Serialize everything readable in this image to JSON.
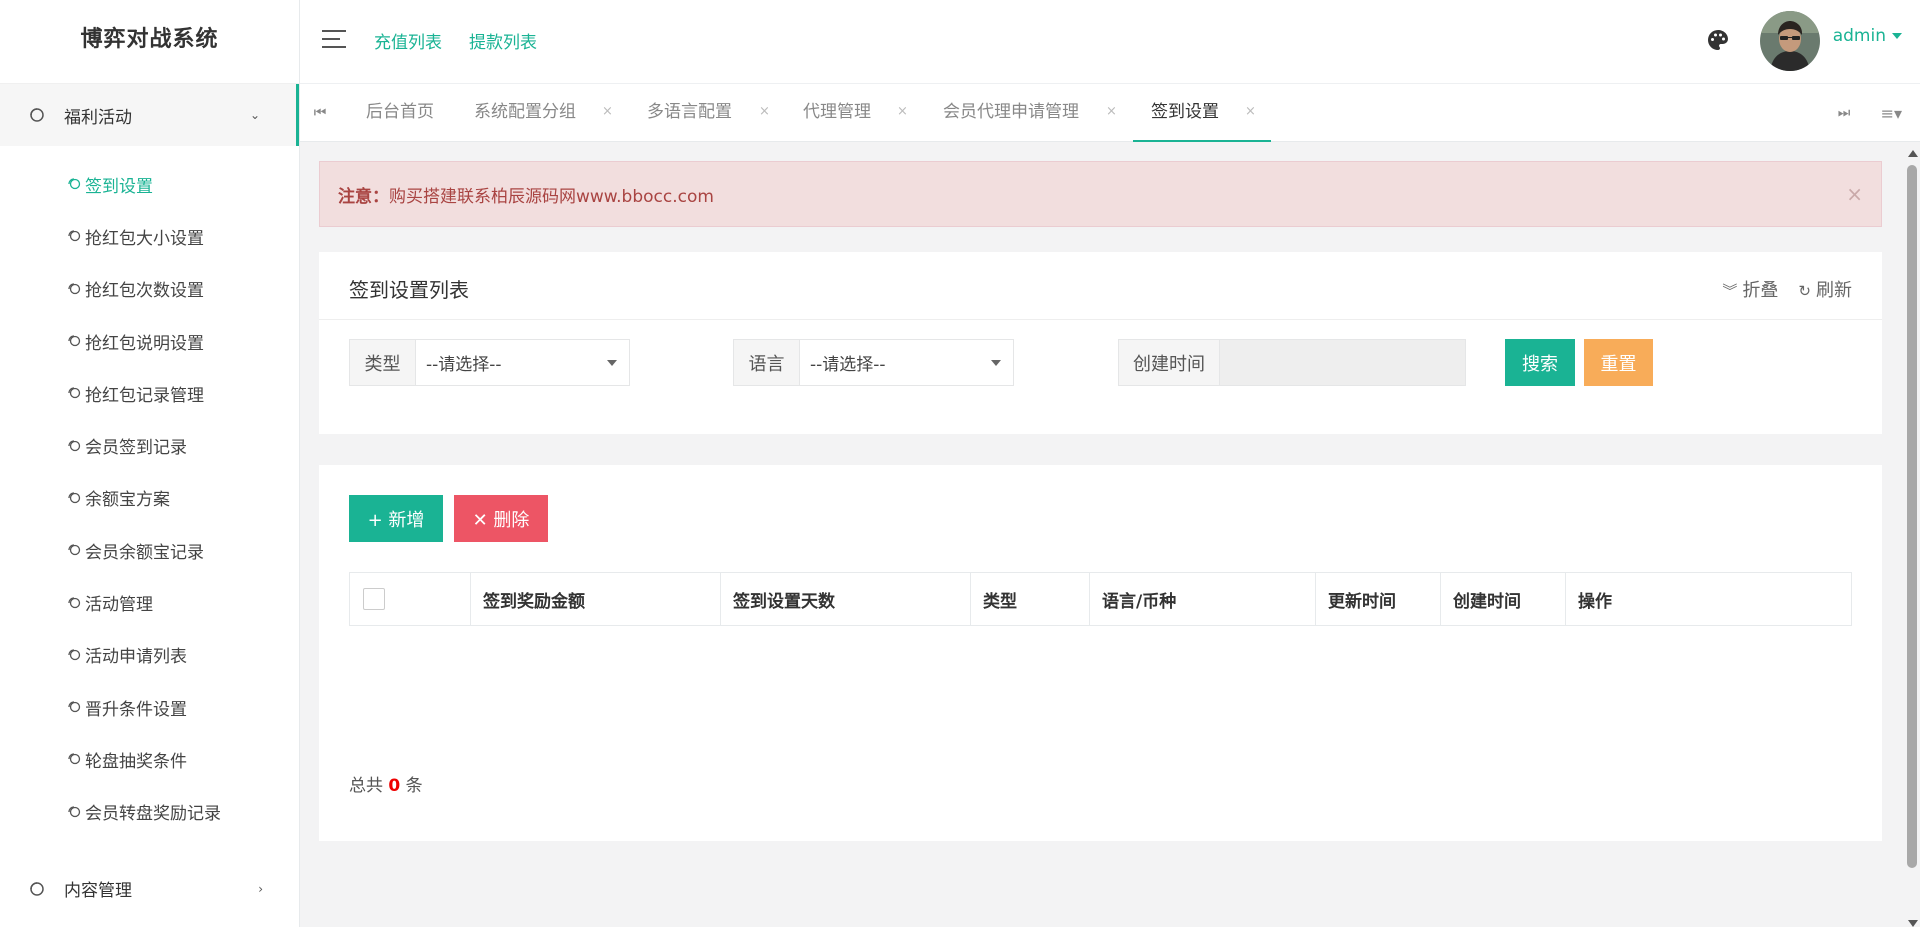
{
  "app": {
    "title": "博弈对战系统"
  },
  "sidebar": {
    "group1": {
      "label": "福利活动"
    },
    "items": [
      {
        "label": "签到设置"
      },
      {
        "label": "抢红包大小设置"
      },
      {
        "label": "抢红包次数设置"
      },
      {
        "label": "抢红包说明设置"
      },
      {
        "label": "抢红包记录管理"
      },
      {
        "label": "会员签到记录"
      },
      {
        "label": "余额宝方案"
      },
      {
        "label": "会员余额宝记录"
      },
      {
        "label": "活动管理"
      },
      {
        "label": "活动申请列表"
      },
      {
        "label": "晋升条件设置"
      },
      {
        "label": "轮盘抽奖条件"
      },
      {
        "label": "会员转盘奖励记录"
      }
    ],
    "group2": {
      "label": "内容管理"
    }
  },
  "header": {
    "links": [
      "充值列表",
      "提款列表"
    ],
    "user": "admin"
  },
  "tabs": [
    {
      "label": "后台首页"
    },
    {
      "label": "系统配置分组"
    },
    {
      "label": "多语言配置"
    },
    {
      "label": "代理管理"
    },
    {
      "label": "会员代理申请管理"
    },
    {
      "label": "签到设置"
    }
  ],
  "alert": {
    "prefix": "注意：",
    "text": "购买搭建联系柏辰源码网www.bbocc.com"
  },
  "panel": {
    "title": "签到设置列表",
    "collapse": "折叠",
    "refresh": "刷新"
  },
  "filters": {
    "type_label": "类型",
    "type_value": "--请选择--",
    "lang_label": "语言",
    "lang_value": "--请选择--",
    "created_label": "创建时间",
    "search": "搜索",
    "reset": "重置"
  },
  "toolbar": {
    "add": "+ 新增",
    "delete": "✕ 删除"
  },
  "table": {
    "columns": [
      "签到奖励金额",
      "签到设置天数",
      "类型",
      "语言/币种",
      "更新时间",
      "创建时间",
      "操作"
    ]
  },
  "footer": {
    "total_prefix": "总共",
    "total_count": "0",
    "total_suffix": "条"
  }
}
